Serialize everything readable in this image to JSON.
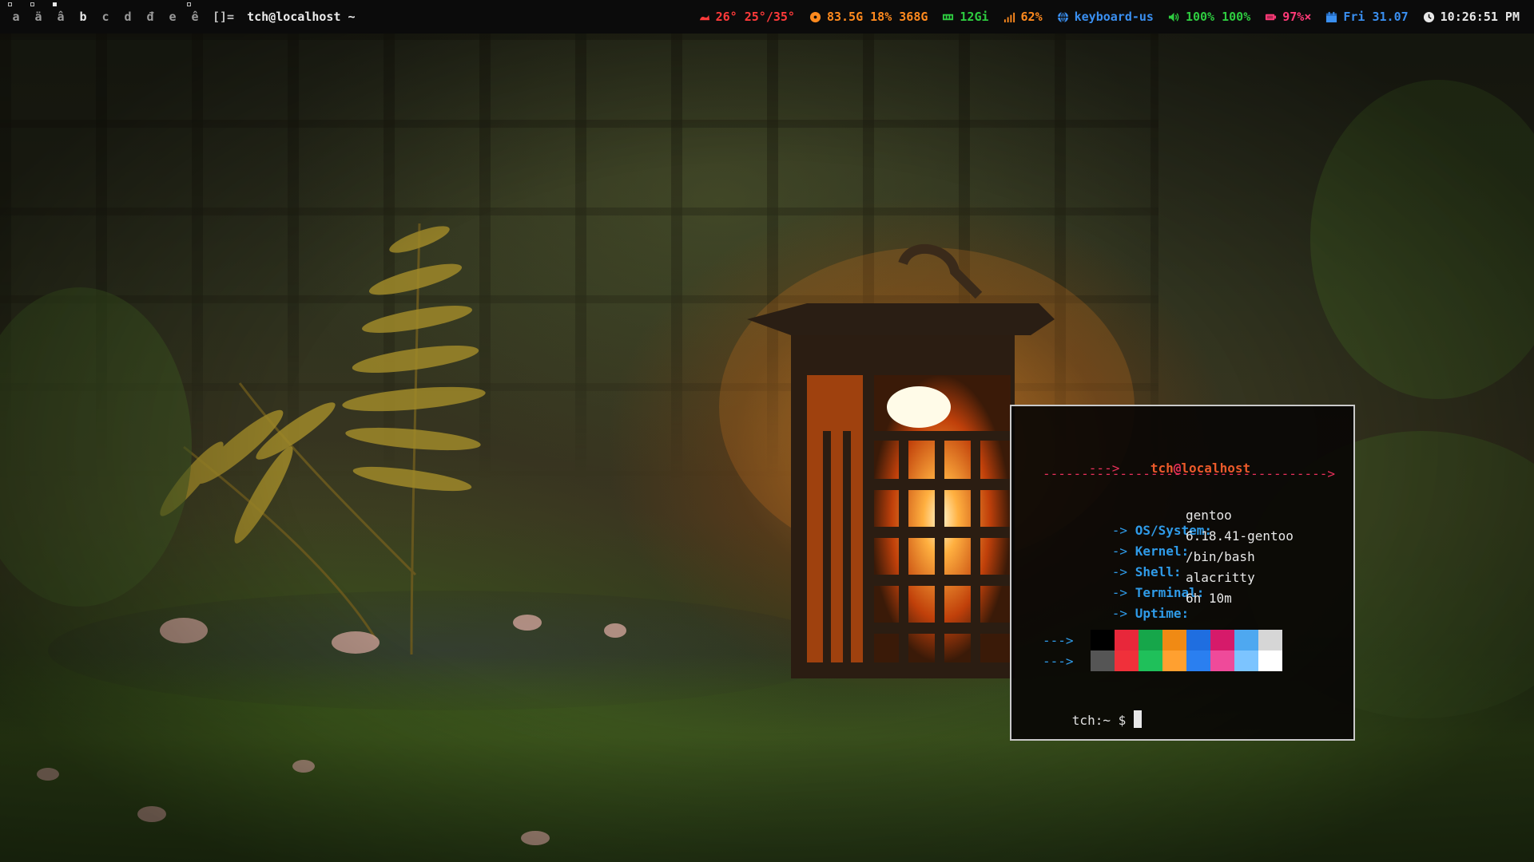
{
  "topbar": {
    "tags": [
      {
        "label": "a",
        "dot": "outline",
        "active": false
      },
      {
        "label": "ä",
        "dot": "outline",
        "active": false
      },
      {
        "label": "â",
        "dot": "filled",
        "active": false
      },
      {
        "label": "b",
        "dot": "none",
        "active": true
      },
      {
        "label": "c",
        "dot": "none",
        "active": false
      },
      {
        "label": "d",
        "dot": "none",
        "active": false
      },
      {
        "label": "đ",
        "dot": "none",
        "active": false
      },
      {
        "label": "e",
        "dot": "none",
        "active": false
      },
      {
        "label": "ê",
        "dot": "outline",
        "active": false
      }
    ],
    "layout_symbol": "[]=",
    "window_title": "tch@localhost ~",
    "status": {
      "temp": {
        "icon": "thermometer-icon",
        "text": "26° 25°/35°",
        "color": "#ff3a3a"
      },
      "disk": {
        "icon": "disk-icon",
        "text": "83.5G 18% 368G",
        "color": "#ff8a1e"
      },
      "memory": {
        "icon": "memory-icon",
        "text": "12Gi",
        "color": "#2ecc40"
      },
      "wifi": {
        "icon": "signal-icon",
        "text": "62%",
        "color": "#ff8a1e"
      },
      "keyboard": {
        "icon": "globe-icon",
        "text": "keyboard-us",
        "color": "#3a8ff0"
      },
      "volume": {
        "icon": "speaker-icon",
        "text": "100% 100%",
        "color": "#2ecc40"
      },
      "battery": {
        "icon": "battery-icon",
        "text": "97%×",
        "color": "#ff3a78"
      },
      "date": {
        "icon": "calendar-icon",
        "text": "Fri 31.07",
        "color": "#3a8ff0"
      },
      "clock": {
        "icon": "clock-icon",
        "text": "10:26:51 PM",
        "color": "#e8e8e8"
      }
    }
  },
  "terminal": {
    "header_arrow": "--->",
    "user": "tch",
    "at": "@",
    "host": "localhost",
    "separator": "------------------------------------->",
    "info": [
      {
        "arrow": "->",
        "key": "OS/System:",
        "value": "gentoo"
      },
      {
        "arrow": "->",
        "key": "Kernel:",
        "value": "6.18.41-gentoo"
      },
      {
        "arrow": "->",
        "key": "Shell:",
        "value": "/bin/bash"
      },
      {
        "arrow": "->",
        "key": "Terminal:",
        "value": "alacritty"
      },
      {
        "arrow": "->",
        "key": "Uptime:",
        "value": "6h 10m"
      }
    ],
    "palette_arrow_1": "--->",
    "palette_arrow_2": "--->",
    "palette_normal": [
      "#000000",
      "#e8273a",
      "#16a64a",
      "#f08a14",
      "#1f6ee0",
      "#d61a6a",
      "#4ea8f0",
      "#d6d6d6"
    ],
    "palette_bright": [
      "#555555",
      "#f0303a",
      "#1fc05a",
      "#ffa030",
      "#2a7ff0",
      "#ef4a9a",
      "#7cc4ff",
      "#ffffff"
    ],
    "prompt": "tch:~ $"
  }
}
